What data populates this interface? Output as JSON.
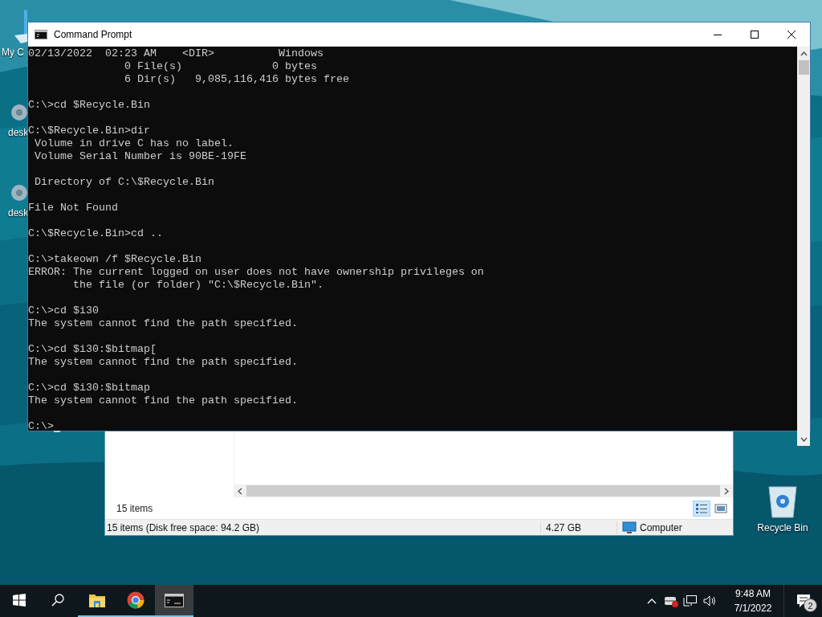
{
  "desktop": {
    "left_icons": [
      {
        "kind": "computer",
        "label": "My C"
      },
      {
        "kind": "gear",
        "label": "desk"
      },
      {
        "kind": "gear",
        "label": "desk"
      }
    ],
    "recycle_bin": {
      "label": "Recycle Bin"
    }
  },
  "explorer": {
    "item_count": "15 items",
    "view_buttons": [
      {
        "kind": "details",
        "selected": true
      },
      {
        "kind": "large_icons",
        "selected": false
      }
    ],
    "status_bar": {
      "summary": "15 items (Disk free space: 94.2 GB)",
      "size": "4.27 GB",
      "location": "Computer"
    }
  },
  "command_prompt": {
    "title": "Command Prompt",
    "blocks": [
      [
        "02/13/2022  02:23 AM    <DIR>          Windows",
        "               0 File(s)              0 bytes",
        "               6 Dir(s)   9,085,116,416 bytes free"
      ],
      [
        "C:\\>cd $Recycle.Bin"
      ],
      [
        "C:\\$Recycle.Bin>dir",
        " Volume in drive C has no label.",
        " Volume Serial Number is 90BE-19FE"
      ],
      [
        " Directory of C:\\$Recycle.Bin"
      ],
      [
        "File Not Found"
      ],
      [
        "C:\\$Recycle.Bin>cd .."
      ],
      [
        "C:\\>takeown /f $Recycle.Bin",
        "ERROR: The current logged on user does not have ownership privileges on",
        "       the file (or folder) \"C:\\$Recycle.Bin\"."
      ],
      [
        "C:\\>cd $i30",
        "The system cannot find the path specified."
      ],
      [
        "C:\\>cd $i30:$bitmap[",
        "The system cannot find the path specified."
      ],
      [
        "C:\\>cd $i30:$bitmap",
        "The system cannot find the path specified."
      ],
      [
        "C:\\>"
      ]
    ],
    "cursor_visible": true
  },
  "taskbar": {
    "items": [
      {
        "kind": "start",
        "running": false,
        "selected": false
      },
      {
        "kind": "search",
        "running": false,
        "selected": false
      },
      {
        "kind": "explorer",
        "running": true,
        "selected": false
      },
      {
        "kind": "chrome",
        "running": true,
        "selected": false
      },
      {
        "kind": "cmd",
        "running": true,
        "selected": true
      }
    ],
    "clock": {
      "time": "9:48 AM",
      "date": "7/1/2022"
    },
    "notifications": {
      "count": "2"
    }
  }
}
